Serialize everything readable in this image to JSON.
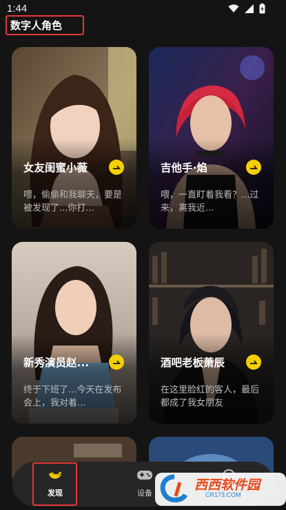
{
  "status": {
    "time": "1:44"
  },
  "header": {
    "title": "数字人角色"
  },
  "cards": [
    {
      "name": "女友闺蜜小薇",
      "desc": "喂，偷偷和我聊天，要是被发现了...你打..."
    },
    {
      "name": "吉他手·焰",
      "desc": "喂，一直盯着我看？...过来，离我近..."
    },
    {
      "name": "新秀演员赵...",
      "desc": "终于下班了...今天在发布会上，我对着..."
    },
    {
      "name": "酒吧老板萧辰",
      "desc": "在这里脸红的客人，最后都成了我女朋友"
    }
  ],
  "nav": {
    "discover": "发现",
    "device": "设备",
    "mine": ""
  },
  "watermark": {
    "brand": "西西软件园",
    "site": "CR173.COM"
  },
  "colors": {
    "accent": "#f5d000",
    "highlight_box": "#e53935",
    "bg": "#141414"
  }
}
